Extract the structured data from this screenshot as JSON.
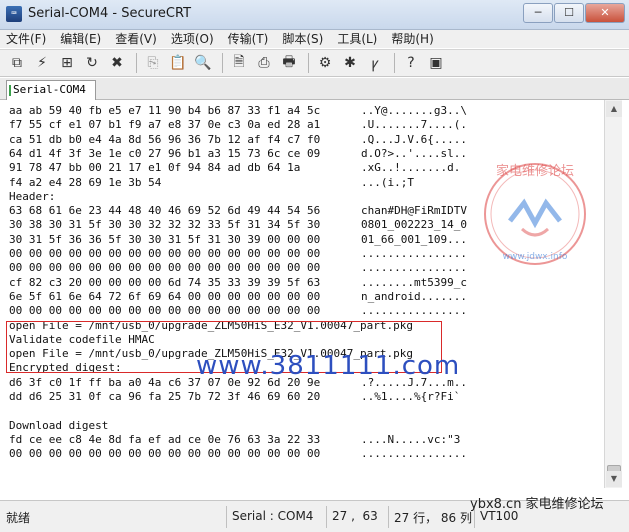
{
  "window": {
    "title": "Serial-COM4 - SecureCRT",
    "icon": "securecrt-app-icon",
    "buttons": [
      "minimize",
      "maximize",
      "close"
    ]
  },
  "menu": [
    "文件(F)",
    "编辑(E)",
    "查看(V)",
    "选项(O)",
    "传输(T)",
    "脚本(S)",
    "工具(L)",
    "帮助(H)"
  ],
  "toolbar": {
    "icons": [
      "connect-icon",
      "quick-connect-icon",
      "connect-tab-icon",
      "reconnect-icon",
      "disconnect-icon",
      "copy-icon",
      "paste-icon",
      "find-icon",
      "print-setup-icon",
      "print-icon",
      "print-screen-icon",
      "session-options-icon",
      "global-options-icon",
      "keymap-icon",
      "help-icon",
      "about-icon"
    ]
  },
  "tab": {
    "label": "Serial-COM4"
  },
  "terminal": {
    "lines": [
      {
        "hex": "aa ab 59 40 fb e5 e7 11 90 b4 b6 87 33 f1 a4 5c",
        "ascii": "..Y@.......g3..\\"
      },
      {
        "hex": "f7 55 cf e1 07 b1 f9 a7 e8 37 0e c3 0a ed 28 a1",
        "ascii": ".U.......7....(."
      },
      {
        "hex": "ca 51 db b0 e4 4a 8d 56 96 36 7b 12 af f4 c7 f0",
        "ascii": ".Q...J.V.6{....."
      },
      {
        "hex": "64 d1 4f 3f 3e 1e c0 27 96 b1 a3 15 73 6c ce 09",
        "ascii": "d.O?>..'....sl.."
      },
      {
        "hex": "91 78 47 bb 00 21 17 e1 0f 94 84 ad db 64 1a",
        "ascii": ".xG..!.......d."
      },
      {
        "hex": "f4 a2 e4 28 69 1e 3b 54",
        "ascii": "...(i.;T"
      },
      {
        "hex": "Header:",
        "ascii": ""
      },
      {
        "hex": "63 68 61 6e 23 44 48 40 46 69 52 6d 49 44 54 56",
        "ascii": "chan#DH@FiRmIDTV"
      },
      {
        "hex": "30 38 30 31 5f 30 30 32 32 32 33 5f 31 34 5f 30",
        "ascii": "0801_002223_14_0"
      },
      {
        "hex": "30 31 5f 36 36 5f 30 30 31 5f 31 30 39 00 00 00",
        "ascii": "01_66_001_109..."
      },
      {
        "hex": "00 00 00 00 00 00 00 00 00 00 00 00 00 00 00 00",
        "ascii": "................"
      },
      {
        "hex": "00 00 00 00 00 00 00 00 00 00 00 00 00 00 00 00",
        "ascii": "................"
      },
      {
        "hex": "cf 82 c3 20 00 00 00 00 6d 74 35 33 39 39 5f 63",
        "ascii": "........mt5399_c"
      },
      {
        "hex": "6e 5f 61 6e 64 72 6f 69 64 00 00 00 00 00 00 00",
        "ascii": "n_android......."
      },
      {
        "hex": "00 00 00 00 00 00 00 00 00 00 00 00 00 00 00 00",
        "ascii": "................"
      },
      {
        "hex": "open File = /mnt/usb_0/upgrade_ZLM50HiS_E32_V1.00047_part.pkg",
        "ascii": ""
      },
      {
        "hex": "Validate codefile HMAC",
        "ascii": ""
      },
      {
        "hex": "open File = /mnt/usb_0/upgrade_ZLM50HiS_E32_V1.00047_part.pkg",
        "ascii": ""
      },
      {
        "hex": "Encrypted digest:",
        "ascii": ""
      },
      {
        "hex": "d6 3f c0 1f ff ba a0 4a c6 37 07 0e 92 6d 20 9e",
        "ascii": ".?.....J.7...m.."
      },
      {
        "hex": "dd d6 25 31 0f ca 96 fa 25 7b 72 3f 46 69 60 20",
        "ascii": "..%1....%{r?Fi` "
      },
      {
        "hex": "",
        "ascii": ""
      },
      {
        "hex": "Download digest",
        "ascii": ""
      },
      {
        "hex": "fd ce ee c8 4e 8d fa ef ad ce 0e 76 63 3a 22 33",
        "ascii": "....N.....vc:\"3"
      },
      {
        "hex": "00 00 00 00 00 00 00 00 00 00 00 00 00 00 00 00",
        "ascii": "................"
      }
    ]
  },
  "watermark": {
    "url": "www.3811111.com",
    "seal_top": "家电维修论坛",
    "seal_bottom": "www.jdwx.info",
    "caption": "ybx8.cn 家电维修论坛"
  },
  "status": {
    "ready": "就绪",
    "connection": "Serial : COM4",
    "position": "27 ,  63",
    "rows_cols": "27 行， 86 列",
    "terminal_type": "VT100"
  }
}
